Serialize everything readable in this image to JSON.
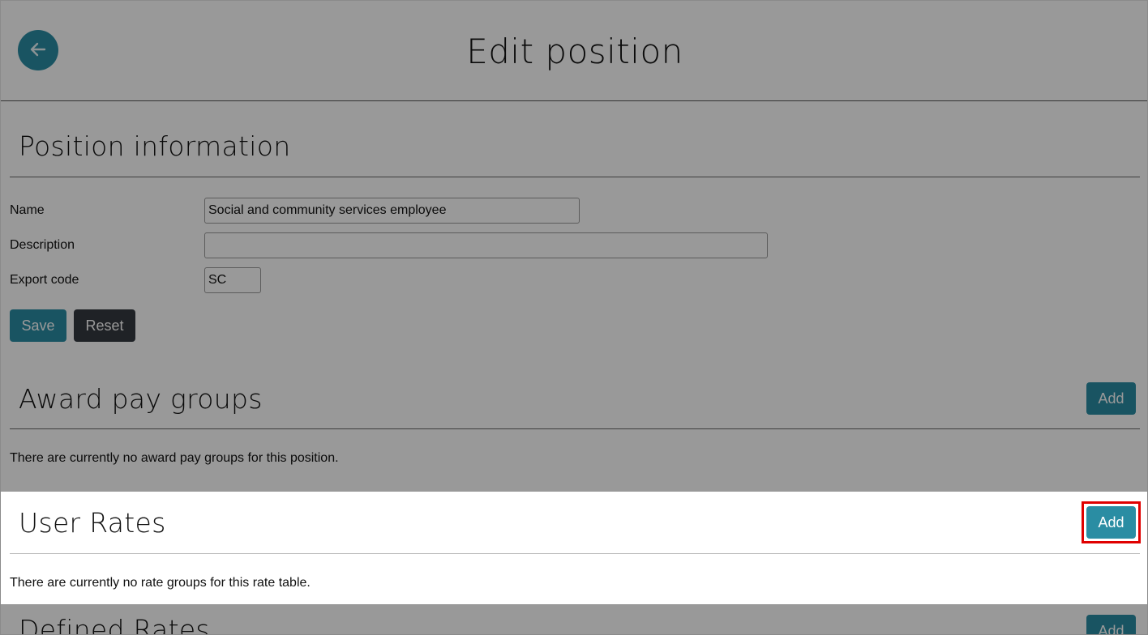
{
  "header": {
    "title": "Edit position",
    "back_icon": "arrow-left-icon"
  },
  "position_info": {
    "title": "Position information",
    "name_label": "Name",
    "name_value": "Social and community services employee",
    "description_label": "Description",
    "description_value": "",
    "export_code_label": "Export code",
    "export_code_value": "SC",
    "save_label": "Save",
    "reset_label": "Reset"
  },
  "award_pay_groups": {
    "title": "Award pay groups",
    "add_label": "Add",
    "empty_text": "There are currently no award pay groups for this position."
  },
  "user_rates": {
    "title": "User Rates",
    "add_label": "Add",
    "empty_text": "There are currently no rate groups for this rate table."
  },
  "defined_rates": {
    "title": "Defined Rates",
    "add_label": "Add"
  },
  "colors": {
    "primary": "#2a8da3",
    "dark": "#343a40",
    "highlight": "#e00000",
    "dim_overlay": "rgba(0,0,0,0.4)"
  }
}
